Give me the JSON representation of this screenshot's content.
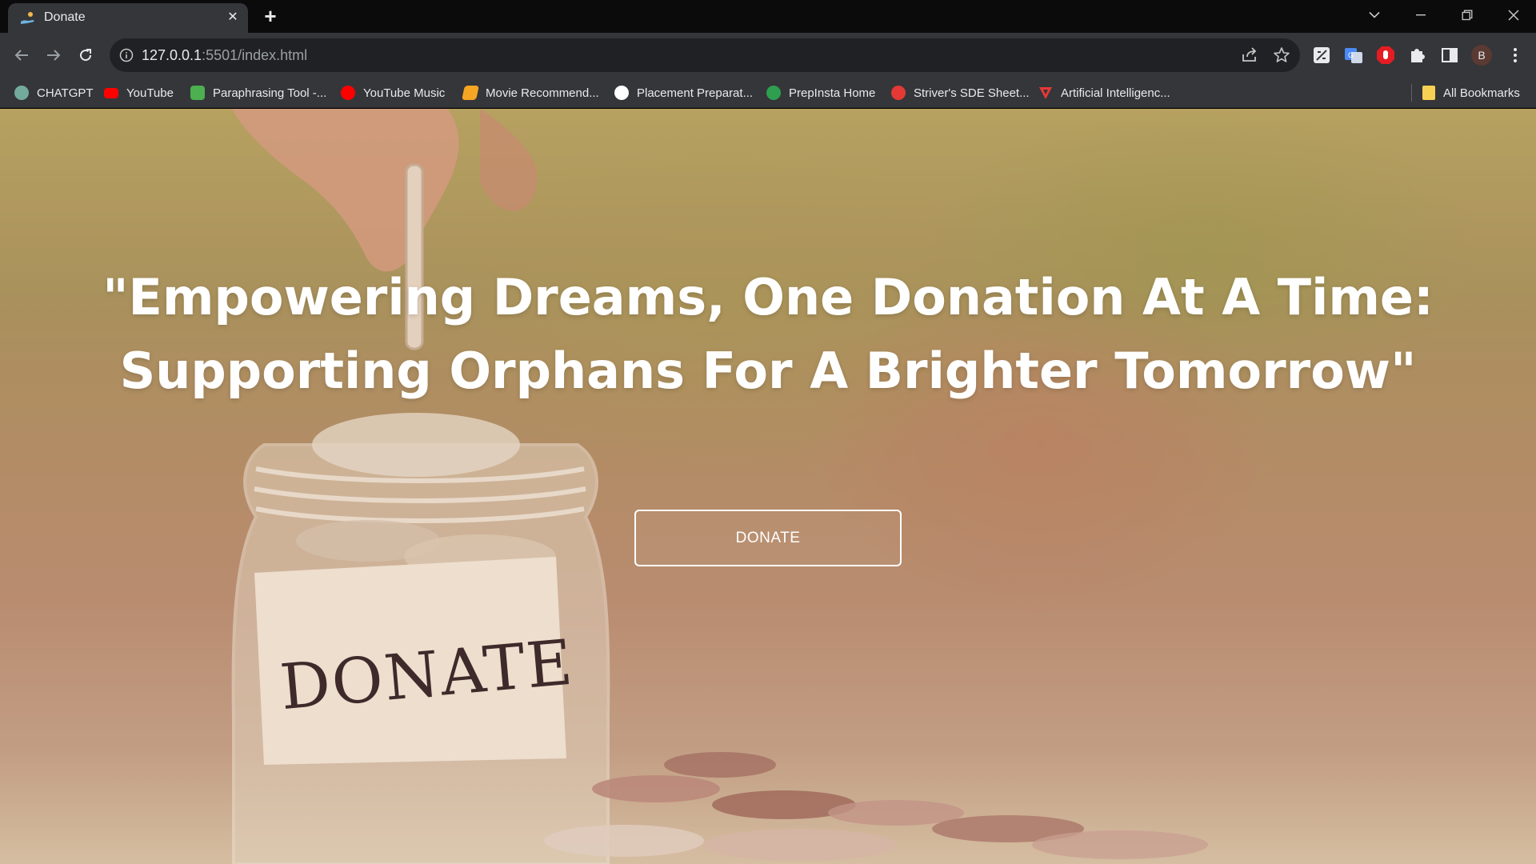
{
  "browser": {
    "tab": {
      "title": "Donate",
      "close_symbol": "✕",
      "favicon": "hand-coin-icon"
    },
    "new_tab_symbol": "+",
    "address": {
      "host": "127.0.0.1",
      "rest": ":5501/index.html"
    },
    "avatar_letter": "B",
    "window_controls": [
      "tab-search-icon",
      "minimize-icon",
      "restore-icon",
      "close-icon"
    ],
    "extensions": [
      "page-compare-icon",
      "google-translate-icon",
      "adblock-icon",
      "extensions-puzzle-icon",
      "side-panel-icon"
    ]
  },
  "bookmarks": [
    {
      "label": "CHATGPT",
      "icon": "chatgpt-icon",
      "color": "#74aa9c"
    },
    {
      "label": "YouTube",
      "icon": "youtube-icon",
      "color": "#ff0000"
    },
    {
      "label": "Paraphrasing Tool -...",
      "icon": "quillbot-icon",
      "color": "#4caf50"
    },
    {
      "label": "YouTube Music",
      "icon": "youtube-music-icon",
      "color": "#ff0000"
    },
    {
      "label": "Movie Recommend...",
      "icon": "movie-icon",
      "color": "#f5a623"
    },
    {
      "label": "Placement Preparat...",
      "icon": "placement-icon",
      "color": "#ffffff"
    },
    {
      "label": "PrepInsta Home",
      "icon": "prepinsta-icon",
      "color": "#2e9e4f"
    },
    {
      "label": "Striver's SDE Sheet...",
      "icon": "tuf-icon",
      "color": "#e53935"
    },
    {
      "label": "Artificial Intelligenc...",
      "icon": "ai-icon",
      "color": "#e53935"
    }
  ],
  "all_bookmarks": {
    "label": "All Bookmarks",
    "icon": "folder-icon",
    "color": "#f7d154"
  },
  "hero": {
    "headline_line1": "\"Empowering Dreams, One Donation At A Time:",
    "headline_line2": "Supporting Orphans For A Brighter Tomorrow\"",
    "jar_label": "DONATE",
    "cta_label": "DONATE"
  }
}
